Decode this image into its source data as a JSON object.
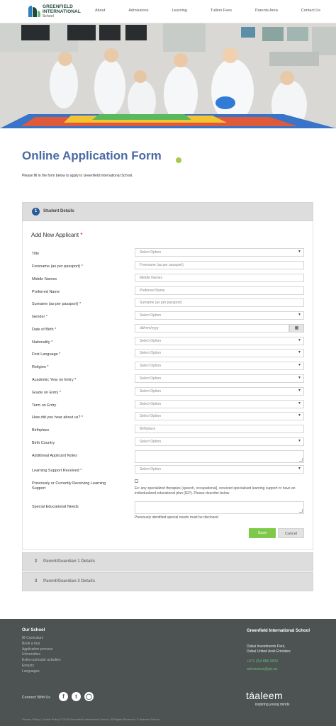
{
  "header": {
    "logo_line1": "GREENFIELD",
    "logo_line2": "INTERNATIONAL",
    "logo_line3": "School",
    "nav": [
      "About",
      "Admissions",
      "Learning",
      "Tuition Fees",
      "Parents Area",
      "Contact Us"
    ]
  },
  "page": {
    "title": "Online Application Form",
    "intro": "Please fill in the form below to apply to Greenfield International School."
  },
  "sections": {
    "student": {
      "number": "1",
      "label": "Student Details"
    },
    "guardian1": {
      "number": "2",
      "label": "Parent/Guardian 1 Details"
    },
    "guardian2": {
      "number": "3",
      "label": "Parent/Guardian 2 Details"
    }
  },
  "form": {
    "add_new": "Add New Applicant",
    "required_mark": "*",
    "fields": {
      "title": {
        "label": "Title",
        "value": "Select Option"
      },
      "forename": {
        "label": "Forename (as per passport)",
        "placeholder": "Forename (as per passport)"
      },
      "middle": {
        "label": "Middle Names",
        "placeholder": "Middle Names"
      },
      "preferred": {
        "label": "Preferred Name",
        "placeholder": "Preferred Name"
      },
      "surname": {
        "label": "Surname (as per passport)",
        "placeholder": "Surname (as per passport)"
      },
      "gender": {
        "label": "Gender",
        "value": "Select Option"
      },
      "dob": {
        "label": "Date of Birth",
        "placeholder": "dd/mm/yyyy"
      },
      "nationality": {
        "label": "Nationality",
        "value": "Select Option"
      },
      "first_language": {
        "label": "First Language",
        "value": "Select Option"
      },
      "religion": {
        "label": "Religion",
        "value": "Select Option"
      },
      "academic_year": {
        "label": "Academic Year on Entry",
        "value": "Select Option"
      },
      "grade": {
        "label": "Grade on Entry",
        "value": "Select Option"
      },
      "term": {
        "label": "Term on Entry",
        "value": "Select Option"
      },
      "hear": {
        "label": "How did you hear about us?",
        "value": "Select Option"
      },
      "birthplace": {
        "label": "Birthplace",
        "placeholder": "Birthplace"
      },
      "birth_country": {
        "label": "Birth Country",
        "value": "Select Option"
      },
      "notes": {
        "label": "Additional Applicant Notes"
      },
      "learning_support": {
        "label": "Learning Support Received",
        "value": "Select Option"
      },
      "previously": {
        "label": "Previously or Currently Receiving Learning Support",
        "help": "Ex: any specialized therapies (speech, occupational), received specialised learning support or have an individualized educational plan (IEP). Please describe below"
      },
      "sen": {
        "label": "Special Educational Needs",
        "help": "Previously identified special needs must be disclosed"
      }
    },
    "save": "Save",
    "cancel": "Cancel"
  },
  "footer": {
    "col_title": "Our School",
    "links": [
      "IB Curriculum",
      "Book a tour",
      "Application process",
      "Universities",
      "Extra-curricular activities",
      "Enquiry",
      "Languages"
    ],
    "school_name": "Greenfield International School",
    "address_line1": "Dubai Investments Park,",
    "address_line2": "Dubai United Arab Emirates",
    "phone": "+971 (0)4 885 6600",
    "email": "admissions@gis.ae",
    "connect": "Connect With Us",
    "brand": "táaleem",
    "brand_tag": "inspiring young minds",
    "bottom": "Privacy Policy | Cookie Policy   © 2018 Greenfield International School. All Rights Reserved. A Taaleem School"
  },
  "colors": {
    "title_blue": "#4a6aa5",
    "accent_green": "#a6c94a",
    "save_green": "#7ec94a",
    "footer_bg": "#4c5352",
    "required_red": "#cc0000"
  }
}
